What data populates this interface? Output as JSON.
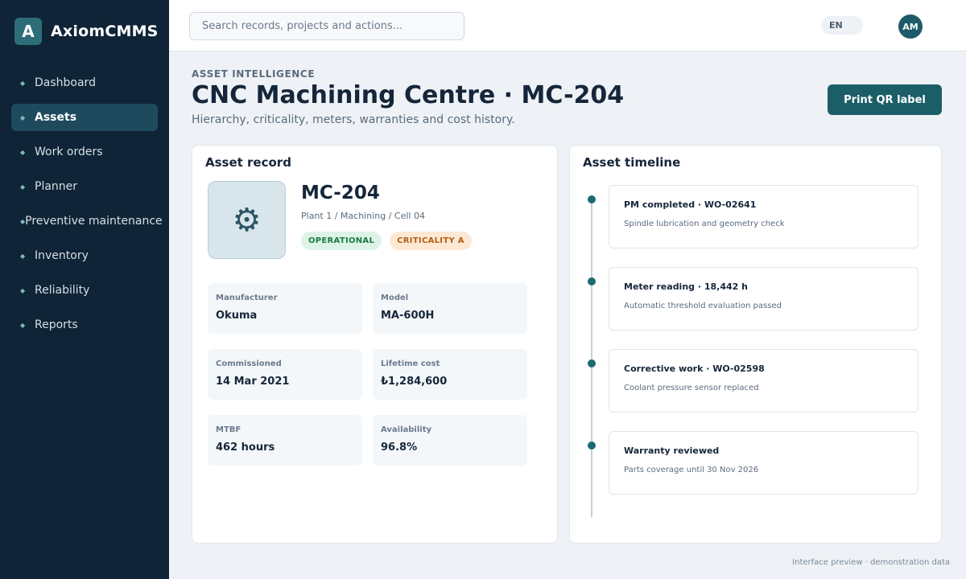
{
  "app": {
    "logo_letter": "A",
    "name": "AxiomCMMS"
  },
  "sidebar": {
    "items": [
      {
        "label": "Dashboard",
        "active": false
      },
      {
        "label": "Assets",
        "active": true
      },
      {
        "label": "Work orders",
        "active": false
      },
      {
        "label": "Planner",
        "active": false
      },
      {
        "label": "Preventive maintenance",
        "active": false
      },
      {
        "label": "Inventory",
        "active": false
      },
      {
        "label": "Reliability",
        "active": false
      },
      {
        "label": "Reports",
        "active": false
      }
    ]
  },
  "topbar": {
    "search_placeholder": "Search records, projects and actions...",
    "language": "EN",
    "avatar_initials": "AM"
  },
  "header": {
    "eyebrow": "ASSET INTELLIGENCE",
    "title": "CNC Machining Centre · MC-204",
    "subtitle": "Hierarchy, criticality, meters, warranties and cost history.",
    "print_button": "Print QR label"
  },
  "record": {
    "title": "Asset record",
    "icon": "gear-icon",
    "asset_id": "MC-204",
    "path": "Plant 1 / Machining / Cell 04",
    "status_badge": "OPERATIONAL",
    "criticality_badge": "CRITICALITY A",
    "fields": [
      {
        "label": "Manufacturer",
        "value": "Okuma"
      },
      {
        "label": "Model",
        "value": "MA-600H"
      },
      {
        "label": "Commissioned",
        "value": "14 Mar 2021"
      },
      {
        "label": "Lifetime cost",
        "value": "₺1,284,600"
      },
      {
        "label": "MTBF",
        "value": "462 hours"
      },
      {
        "label": "Availability",
        "value": "96.8%"
      }
    ]
  },
  "timeline": {
    "title": "Asset timeline",
    "items": [
      {
        "title": "PM completed · WO-02641",
        "desc": "Spindle lubrication and geometry check"
      },
      {
        "title": "Meter reading · 18,442 h",
        "desc": "Automatic threshold evaluation passed"
      },
      {
        "title": "Corrective work · WO-02598",
        "desc": "Coolant pressure sensor replaced"
      },
      {
        "title": "Warranty reviewed",
        "desc": "Parts coverage until 30 Nov 2026"
      }
    ]
  },
  "footer": {
    "note": "Interface preview · demonstration data"
  },
  "colors": {
    "sidebar": "#0f2436",
    "accent": "#1c5e68",
    "active_nav": "#1f4a5e",
    "operational": "#1c7a44",
    "criticality": "#b35d12"
  }
}
